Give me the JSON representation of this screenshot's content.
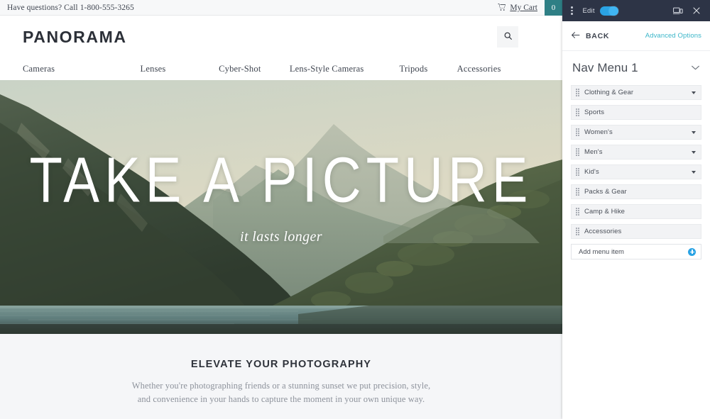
{
  "site": {
    "utility": {
      "phone_text": "Have questions? Call 1-800-555-3265",
      "cart_label": "My Cart",
      "cart_count": "0",
      "cart_badge_color": "#2e7f85",
      "cart_icon": "shopping-cart-icon"
    },
    "brand": "PANORAMA",
    "search_icon": "search-icon",
    "nav": [
      {
        "label": "Cameras"
      },
      {
        "label": "Lenses"
      },
      {
        "label": "Cyber-Shot"
      },
      {
        "label": "Lens-Style Cameras"
      },
      {
        "label": "Tripods"
      },
      {
        "label": "Accessories"
      }
    ],
    "hero": {
      "title": "TAKE A PICTURE",
      "subtitle": "it lasts longer"
    },
    "intro": {
      "heading": "ELEVATE YOUR PHOTOGRAPHY",
      "line1": "Whether you're photographing friends or a stunning sunset we put precision, style,",
      "line2": "and convenience in your hands to capture the moment in your own unique way."
    }
  },
  "editor": {
    "topbar": {
      "kebab_icon": "more-vertical-icon",
      "edit_label": "Edit",
      "toggle_state": "on",
      "toggle_color": "#2aa3e4",
      "device_icon": "device-preview-icon",
      "close_icon": "close-icon"
    },
    "subbar": {
      "back_icon": "arrow-left-icon",
      "back_label": "BACK",
      "advanced_label": "Advanced Options",
      "advanced_color": "#3bb6c9"
    },
    "menu": {
      "title": "Nav Menu 1",
      "collapse_icon": "chevron-down-icon",
      "items": [
        {
          "label": "Clothing & Gear",
          "has_caret": true
        },
        {
          "label": "Sports",
          "has_caret": false
        },
        {
          "label": "Women's",
          "has_caret": true
        },
        {
          "label": "Men's",
          "has_caret": true
        },
        {
          "label": "Kid's",
          "has_caret": true
        },
        {
          "label": "Packs & Gear",
          "has_caret": false
        },
        {
          "label": "Camp & Hike",
          "has_caret": false
        },
        {
          "label": "Accessories",
          "has_caret": false
        }
      ],
      "add_label": "Add menu item",
      "add_icon": "plus-circle-icon"
    }
  }
}
